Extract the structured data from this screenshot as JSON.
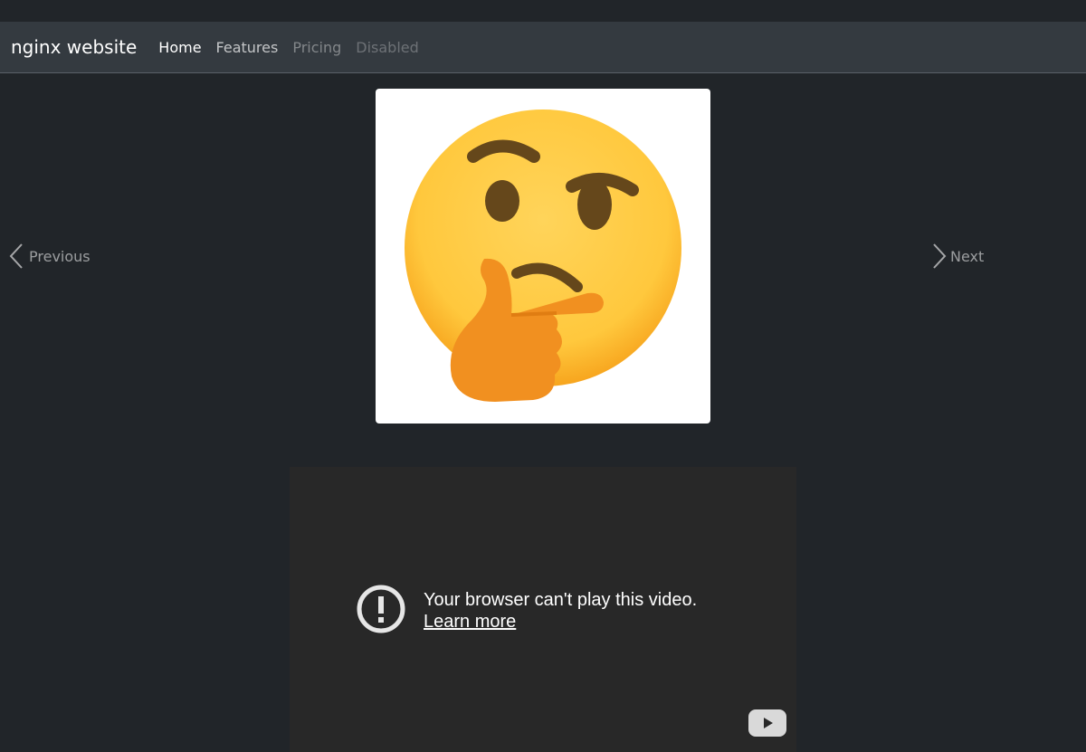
{
  "navbar": {
    "brand": "nginx website",
    "links": [
      {
        "label": "Home"
      },
      {
        "label": "Features"
      },
      {
        "label": "Pricing"
      },
      {
        "label": "Disabled"
      }
    ]
  },
  "carousel": {
    "image_icon": "thinking-face-emoji",
    "prev_label": "Previous",
    "next_label": "Next"
  },
  "video": {
    "error_message": "Your browser can't play this video.",
    "learn_more": "Learn more",
    "error_icon": "exclamation-circle-icon",
    "logo_icon": "youtube-play-icon"
  },
  "colors": {
    "page_bg": "#212529",
    "navbar_bg": "#343a40",
    "video_bg": "#282828",
    "emoji_face": "#ffcb4c",
    "emoji_hand": "#f19020",
    "emoji_features": "#65471b"
  }
}
